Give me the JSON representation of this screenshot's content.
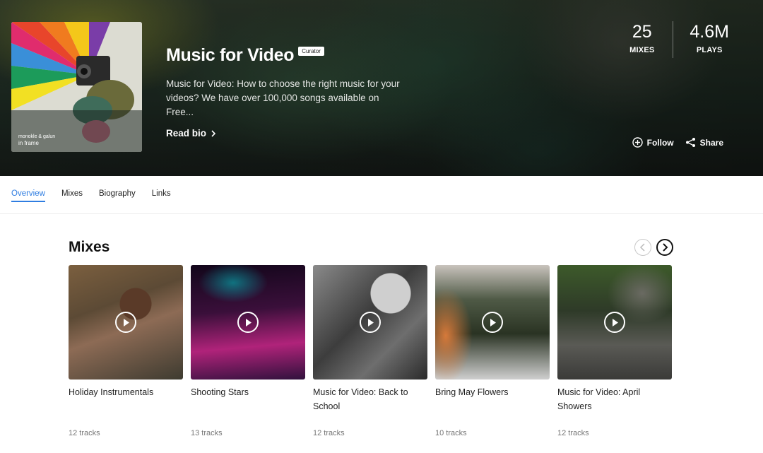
{
  "hero": {
    "title": "Music for Video",
    "badge": "Curator",
    "description": "Music for Video: How to choose the right music for your videos? We have over 100,000 songs available on Free...",
    "read_bio": "Read bio",
    "cover_line1": "monokle & galun",
    "cover_line2": "in frame"
  },
  "stats": [
    {
      "value": "25",
      "label": "MIXES"
    },
    {
      "value": "4.6M",
      "label": "PLAYS"
    }
  ],
  "actions": {
    "follow": "Follow",
    "share": "Share"
  },
  "tabs": [
    {
      "label": "Overview",
      "active": true
    },
    {
      "label": "Mixes"
    },
    {
      "label": "Biography"
    },
    {
      "label": "Links"
    }
  ],
  "mixes": {
    "title": "Mixes",
    "cards": [
      {
        "title": "Holiday Instrumentals",
        "tracks": "12 tracks"
      },
      {
        "title": "Shooting Stars",
        "tracks": "13 tracks"
      },
      {
        "title": "Music for Video: Back to School",
        "tracks": "12 tracks"
      },
      {
        "title": "Bring May Flowers",
        "tracks": "10 tracks"
      },
      {
        "title": "Music for Video: April Showers",
        "tracks": "12 tracks"
      }
    ]
  },
  "colors": {
    "accent": "#2f7de1",
    "text": "#222222",
    "muted": "#777777"
  }
}
